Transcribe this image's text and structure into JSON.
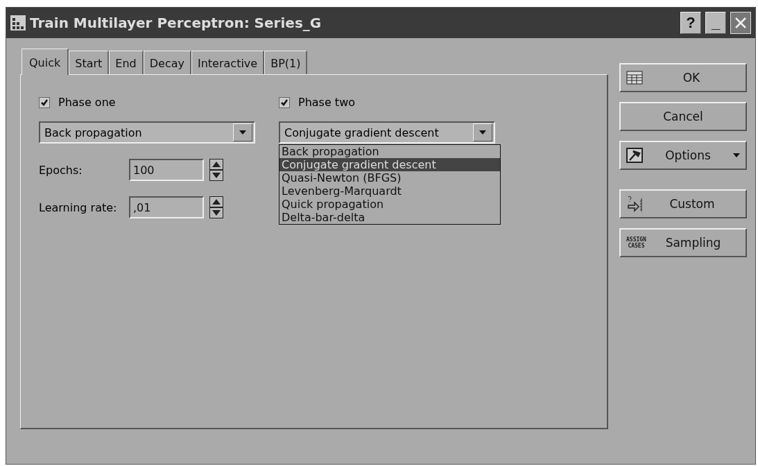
{
  "window": {
    "title": "Train Multilayer Perceptron: Series_G",
    "controls": [
      "?",
      "_"
    ]
  },
  "tabs": [
    {
      "label": "Quick",
      "selected": true
    },
    {
      "label": "Start",
      "selected": false
    },
    {
      "label": "End",
      "selected": false
    },
    {
      "label": "Decay",
      "selected": false
    },
    {
      "label": "Interactive",
      "selected": false
    },
    {
      "label": "BP(1)",
      "selected": false
    }
  ],
  "phase_one": {
    "label": "Phase one",
    "checked": true,
    "algorithm": "Back propagation"
  },
  "phase_two": {
    "label": "Phase two",
    "checked": true,
    "algorithm": "Conjugate gradient descent",
    "options": [
      {
        "label": "Back propagation",
        "selected": false
      },
      {
        "label": "Conjugate gradient descent",
        "selected": true
      },
      {
        "label": "Quasi-Newton (BFGS)",
        "selected": false
      },
      {
        "label": "Levenberg-Marquardt",
        "selected": false
      },
      {
        "label": "Quick propagation",
        "selected": false
      },
      {
        "label": "Delta-bar-delta",
        "selected": false
      }
    ]
  },
  "fields": [
    {
      "label": "Epochs:",
      "value": "100"
    },
    {
      "label": "Learning rate:",
      "value": ",01"
    }
  ],
  "buttons": [
    {
      "kind": "ok",
      "label": "OK"
    },
    {
      "kind": "plain",
      "label": "Cancel"
    },
    {
      "kind": "options",
      "label": "Options"
    },
    {
      "kind": "custom",
      "label": "Custom"
    },
    {
      "kind": "sampling",
      "label": "Sampling",
      "icon_text": [
        "ASSIGN",
        "CASES"
      ]
    }
  ]
}
